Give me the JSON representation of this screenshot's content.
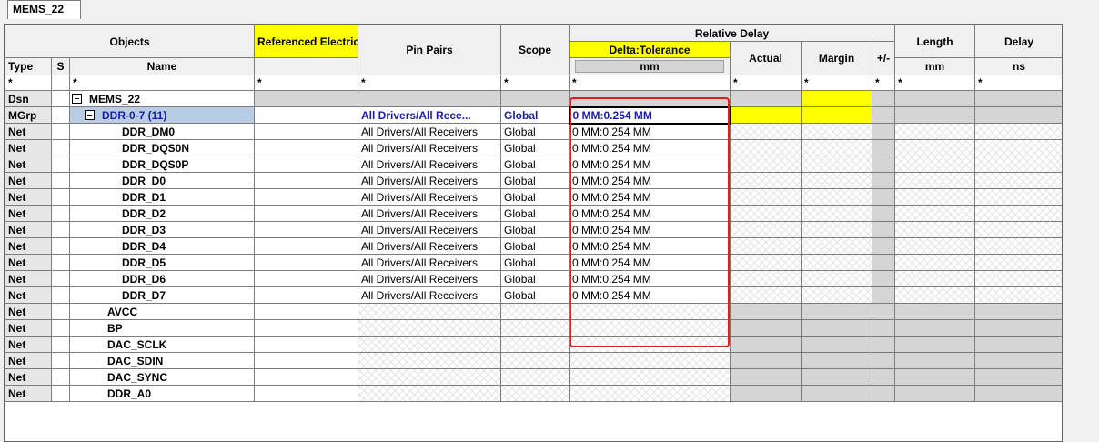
{
  "tab": {
    "label": "MEMS_22"
  },
  "header": {
    "objects": "Objects",
    "referenced": "Referenced Electrical CSet",
    "pin_pairs": "Pin Pairs",
    "scope": "Scope",
    "relative_delay": "Relative Delay",
    "delta_tolerance": "Delta:Tolerance",
    "actual": "Actual",
    "margin": "Margin",
    "plusminus": "+/-",
    "length": "Length",
    "delay": "Delay",
    "type": "Type",
    "s": "S",
    "name": "Name",
    "unit_dt": "mm",
    "unit_length": "mm",
    "unit_delay": "ns"
  },
  "filter": {
    "type": "*",
    "name": "*",
    "referenced": "*",
    "pin_pairs": "*",
    "scope": "*",
    "delta_tolerance": "*",
    "actual": "*",
    "margin": "*",
    "plusminus": "*",
    "length": "*",
    "delay": "*"
  },
  "rows": [
    {
      "type": "Dsn",
      "name": "MEMS_22",
      "pin_pairs": "",
      "scope": "",
      "dt": ""
    },
    {
      "type": "MGrp",
      "name": "DDR-0-7 (11)",
      "pin_pairs": "All Drivers/All Rece...",
      "scope": "Global",
      "dt": "0 MM:0.254 MM"
    },
    {
      "type": "Net",
      "name": "DDR_DM0",
      "pin_pairs": "All Drivers/All Receivers",
      "scope": "Global",
      "dt": "0 MM:0.254 MM"
    },
    {
      "type": "Net",
      "name": "DDR_DQS0N",
      "pin_pairs": "All Drivers/All Receivers",
      "scope": "Global",
      "dt": "0 MM:0.254 MM"
    },
    {
      "type": "Net",
      "name": "DDR_DQS0P",
      "pin_pairs": "All Drivers/All Receivers",
      "scope": "Global",
      "dt": "0 MM:0.254 MM"
    },
    {
      "type": "Net",
      "name": "DDR_D0",
      "pin_pairs": "All Drivers/All Receivers",
      "scope": "Global",
      "dt": "0 MM:0.254 MM"
    },
    {
      "type": "Net",
      "name": "DDR_D1",
      "pin_pairs": "All Drivers/All Receivers",
      "scope": "Global",
      "dt": "0 MM:0.254 MM"
    },
    {
      "type": "Net",
      "name": "DDR_D2",
      "pin_pairs": "All Drivers/All Receivers",
      "scope": "Global",
      "dt": "0 MM:0.254 MM"
    },
    {
      "type": "Net",
      "name": "DDR_D3",
      "pin_pairs": "All Drivers/All Receivers",
      "scope": "Global",
      "dt": "0 MM:0.254 MM"
    },
    {
      "type": "Net",
      "name": "DDR_D4",
      "pin_pairs": "All Drivers/All Receivers",
      "scope": "Global",
      "dt": "0 MM:0.254 MM"
    },
    {
      "type": "Net",
      "name": "DDR_D5",
      "pin_pairs": "All Drivers/All Receivers",
      "scope": "Global",
      "dt": "0 MM:0.254 MM"
    },
    {
      "type": "Net",
      "name": "DDR_D6",
      "pin_pairs": "All Drivers/All Receivers",
      "scope": "Global",
      "dt": "0 MM:0.254 MM"
    },
    {
      "type": "Net",
      "name": "DDR_D7",
      "pin_pairs": "All Drivers/All Receivers",
      "scope": "Global",
      "dt": "0 MM:0.254 MM"
    },
    {
      "type": "Net",
      "name": "AVCC",
      "pin_pairs": "",
      "scope": "",
      "dt": ""
    },
    {
      "type": "Net",
      "name": "BP",
      "pin_pairs": "",
      "scope": "",
      "dt": ""
    },
    {
      "type": "Net",
      "name": "DAC_SCLK",
      "pin_pairs": "",
      "scope": "",
      "dt": ""
    },
    {
      "type": "Net",
      "name": "DAC_SDIN",
      "pin_pairs": "",
      "scope": "",
      "dt": ""
    },
    {
      "type": "Net",
      "name": "DAC_SYNC",
      "pin_pairs": "",
      "scope": "",
      "dt": ""
    },
    {
      "type": "Net",
      "name": "DDR_A0",
      "pin_pairs": "",
      "scope": "",
      "dt": ""
    }
  ],
  "colors": {
    "highlight_yellow": "#ffff00",
    "selection_blue": "#b8cce4",
    "annotation_red": "#e21e1e",
    "group_text_blue": "#1b1bb0"
  }
}
